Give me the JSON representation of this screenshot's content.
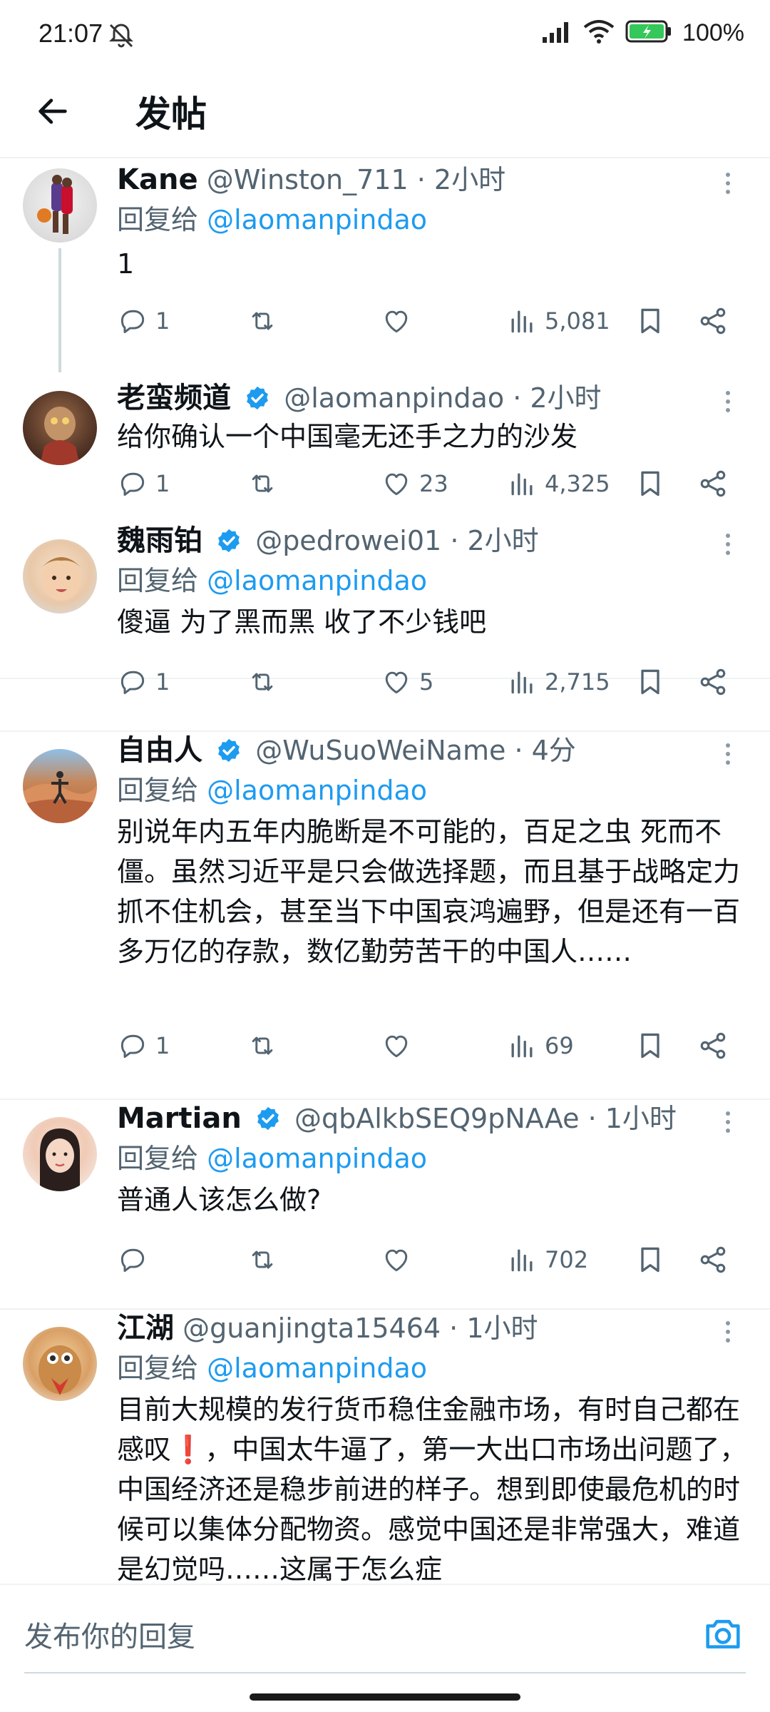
{
  "status_bar": {
    "time": "21:07",
    "battery": "100%",
    "icons": [
      "bell-off-icon",
      "signal-icon",
      "wifi-icon",
      "battery-charging-icon"
    ]
  },
  "app_bar": {
    "title": "发帖",
    "back_icon": "arrow-left-icon"
  },
  "reply_prefix": "回复给",
  "posts": [
    {
      "name": "Kane",
      "verified": false,
      "handle": "@Winston_711",
      "time": "2小时",
      "reply_to": "@laomanpindao",
      "text": "1",
      "replies": "1",
      "retweets": "",
      "likes": "",
      "views": "5,081"
    },
    {
      "name": "老蛮频道",
      "verified": true,
      "handle": "@laomanpindao",
      "time": "2小时",
      "reply_to": "",
      "text": "给你确认一个中国毫无还手之力的沙发",
      "replies": "1",
      "retweets": "",
      "likes": "23",
      "views": "4,325"
    },
    {
      "name": "魏雨铂",
      "verified": true,
      "handle": "@pedrowei01",
      "time": "2小时",
      "reply_to": "@laomanpindao",
      "text": "傻逼 为了黑而黑 收了不少钱吧",
      "replies": "1",
      "retweets": "",
      "likes": "5",
      "views": "2,715"
    },
    {
      "name": "自由人",
      "verified": true,
      "handle": "@WuSuoWeiName",
      "time": "4分",
      "reply_to": "@laomanpindao",
      "text": "别说年内五年内脆断是不可能的，百足之虫 死而不僵。虽然习近平是只会做选择题，而且基于战略定力抓不住机会，甚至当下中国哀鸿遍野，但是还有一百多万亿的存款，数亿勤劳苦干的中国人……",
      "replies": "1",
      "retweets": "",
      "likes": "",
      "views": "69"
    },
    {
      "name": "Martian",
      "verified": true,
      "handle": "@qbAlkbSEQ9pNAAe",
      "time": "1小时",
      "reply_to": "@laomanpindao",
      "text": "普通人该怎么做?",
      "replies": "",
      "retweets": "",
      "likes": "",
      "views": "702"
    },
    {
      "name": "江湖",
      "verified": false,
      "handle": "@guanjingta15464",
      "time": "1小时",
      "reply_to": "@laomanpindao",
      "text": "目前大规模的发行货币稳住金融市场，有时自己都在感叹❗，中国太牛逼了，第一大出口市场出问题了，中国经济还是稳步前进的样子。想到即使最危机的时候可以集体分配物资。感觉中国还是非常强大，难道是幻觉吗……这属于怎么症",
      "replies": "",
      "retweets": "",
      "likes": "",
      "views": ""
    }
  ],
  "reply_bar": {
    "placeholder": "发布你的回复",
    "camera_icon": "camera-icon"
  },
  "colors": {
    "link": "#1d9bf0",
    "secondary_text": "#536471",
    "verified": "#1d9bf0",
    "divider": "#eff3f4"
  }
}
